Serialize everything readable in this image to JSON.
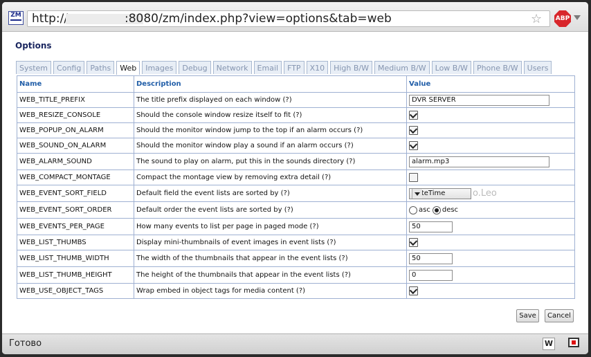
{
  "browser": {
    "url_prefix": "http://",
    "url_rest": ":8080/zm/index.php?view=options&tab=web",
    "status_text": "Готово"
  },
  "page": {
    "title": "Options"
  },
  "tabs": [
    "System",
    "Config",
    "Paths",
    "Web",
    "Images",
    "Debug",
    "Network",
    "Email",
    "FTP",
    "X10",
    "High B/W",
    "Medium B/W",
    "Low B/W",
    "Phone B/W",
    "Users"
  ],
  "active_tab": "Web",
  "table": {
    "headers": {
      "name": "Name",
      "description": "Description",
      "value": "Value"
    },
    "rows": [
      {
        "name": "WEB_TITLE_PREFIX",
        "description": "The title prefix displayed on each window (?)",
        "value": "DVR SERVER"
      },
      {
        "name": "WEB_RESIZE_CONSOLE",
        "description": "Should the console window resize itself to fit (?)",
        "value": "checked"
      },
      {
        "name": "WEB_POPUP_ON_ALARM",
        "description": "Should the monitor window jump to the top if an alarm occurs (?)",
        "value": "checked"
      },
      {
        "name": "WEB_SOUND_ON_ALARM",
        "description": "Should the monitor window play a sound if an alarm occurs (?)",
        "value": "checked"
      },
      {
        "name": "WEB_ALARM_SOUND",
        "description": "The sound to play on alarm, put this in the sounds directory (?)",
        "value": "alarm.mp3"
      },
      {
        "name": "WEB_COMPACT_MONTAGE",
        "description": "Compact the montage view by removing extra detail (?)",
        "value": "unchecked"
      },
      {
        "name": "WEB_EVENT_SORT_FIELD",
        "description": "Default field the event lists are sorted by (?)",
        "value": "DateTime"
      },
      {
        "name": "WEB_EVENT_SORT_ORDER",
        "description": "Default order the event lists are sorted by (?)",
        "value": "desc",
        "options": [
          "asc",
          "desc"
        ]
      },
      {
        "name": "WEB_EVENTS_PER_PAGE",
        "description": "How many events to list per page in paged mode (?)",
        "value": "50"
      },
      {
        "name": "WEB_LIST_THUMBS",
        "description": "Display mini-thumbnails of event images in event lists (?)",
        "value": "checked"
      },
      {
        "name": "WEB_LIST_THUMB_WIDTH",
        "description": "The width of the thumbnails that appear in the event lists (?)",
        "value": "50"
      },
      {
        "name": "WEB_LIST_THUMB_HEIGHT",
        "description": "The height of the thumbnails that appear in the event lists (?)",
        "value": "0"
      },
      {
        "name": "WEB_USE_OBJECT_TAGS",
        "description": "Wrap embed in object tags for media content (?)",
        "value": "checked"
      }
    ]
  },
  "watermark": "o.Leo",
  "buttons": {
    "save": "Save",
    "cancel": "Cancel"
  },
  "icons": {
    "app": "zm-logo-icon",
    "bookmark": "star-icon",
    "adblock": "abp-icon",
    "status_w": "w-icon",
    "status_tv": "tv-icon"
  },
  "colors": {
    "header_text": "#215ea8",
    "title_text": "#1b2760",
    "tab_inactive": "#8595b0",
    "border": "#9eb0d2"
  }
}
